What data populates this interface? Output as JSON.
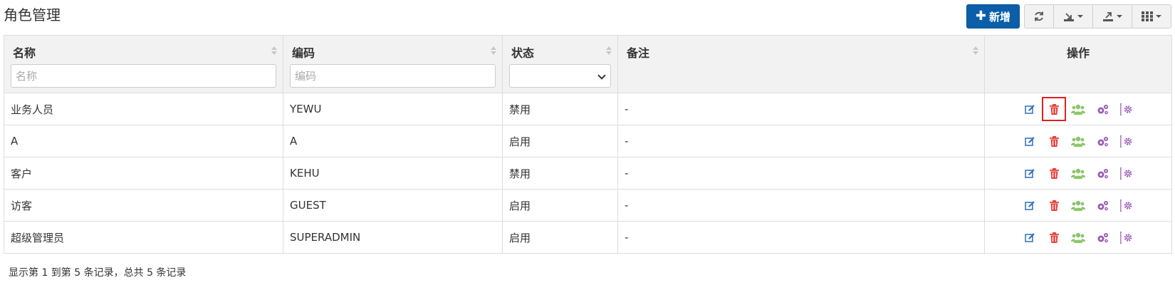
{
  "page": {
    "title": "角色管理"
  },
  "toolbar": {
    "add_label": "新增"
  },
  "table": {
    "columns": [
      {
        "label": "名称",
        "placeholder": "名称"
      },
      {
        "label": "编码",
        "placeholder": "编码"
      },
      {
        "label": "状态"
      },
      {
        "label": "备注"
      },
      {
        "label": "操作"
      }
    ],
    "rows": [
      {
        "name": "业务人员",
        "code": "YEWU",
        "status": "禁用",
        "remark": "-"
      },
      {
        "name": "A",
        "code": "A",
        "status": "启用",
        "remark": "-"
      },
      {
        "name": "客户",
        "code": "KEHU",
        "status": "禁用",
        "remark": "-"
      },
      {
        "name": "访客",
        "code": "GUEST",
        "status": "启用",
        "remark": "-"
      },
      {
        "name": "超级管理员",
        "code": "SUPERADMIN",
        "status": "启用",
        "remark": "-"
      }
    ]
  },
  "footer": {
    "summary": "显示第 1 到第 5 条记录，总共 5 条记录"
  },
  "colors": {
    "primary": "#0b5fa8",
    "edit_icon": "#2f6fb7",
    "delete_icon": "#e8413a",
    "users_icon": "#8cc66a",
    "cogs_icon": "#9b59b6",
    "disabled_status": "#e8826f",
    "enabled_status": "#5cb85c",
    "highlight": "#e02020"
  },
  "icons": [
    "edit-icon",
    "trash-icon",
    "users-icon",
    "cogs-icon",
    "settings-icon"
  ]
}
